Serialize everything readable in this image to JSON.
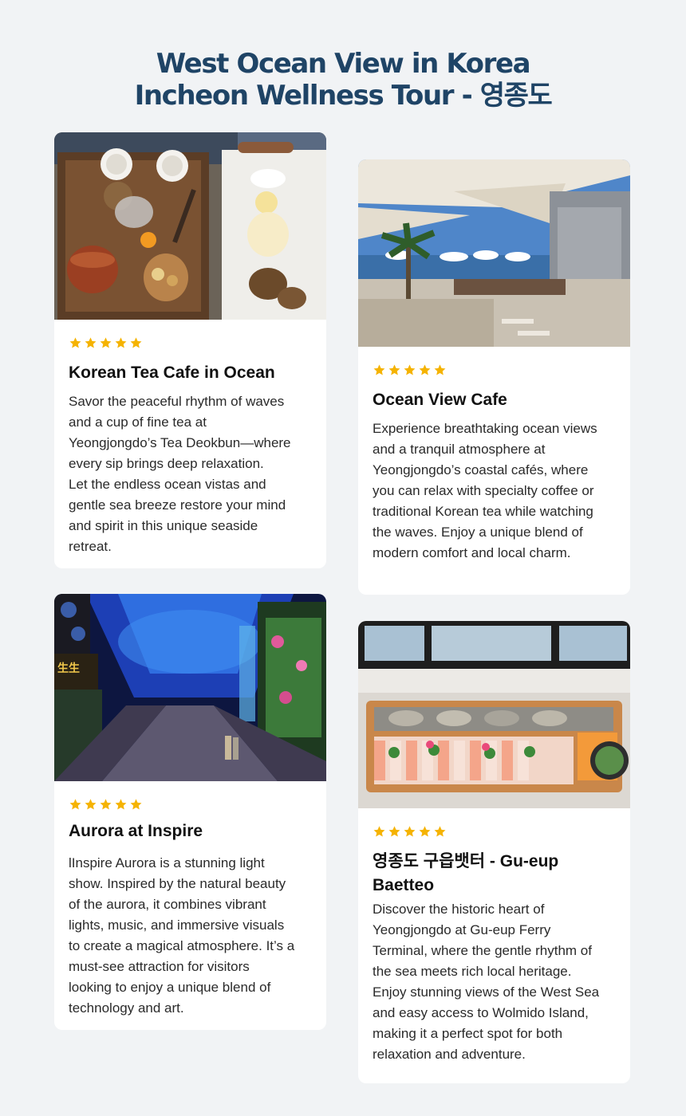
{
  "header": {
    "title_line1": "West Ocean View in Korea",
    "title_line2": "Incheon Wellness Tour - 영종도"
  },
  "colors": {
    "background": "#f1f3f5",
    "title": "#1f4466",
    "star": "#f5b301",
    "card": "#ffffff"
  },
  "cards": [
    {
      "rating": 5,
      "photo": "tea-set-photo",
      "title": "Korean Tea Cafe in Ocean",
      "description": "Savor the peaceful rhythm of waves\nand a cup of fine tea at\nYeongjongdo’s Tea Deokbun—where\nevery sip brings deep relaxation.\nLet the endless ocean vistas and\ngentle sea breeze restore your mind\nand spirit in this unique seaside\nretreat."
    },
    {
      "rating": 5,
      "photo": "ocean-terrace-photo",
      "title": "Ocean View Cafe",
      "description": "Experience breathtaking ocean views\nand a tranquil atmosphere at\nYeongjongdo’s coastal cafés, where\nyou can relax with specialty coffee or\ntraditional Korean tea while watching\nthe waves. Enjoy a unique blend of\nmodern comfort and local charm."
    },
    {
      "rating": 5,
      "photo": "aurora-light-show-photo",
      "title": "Aurora at Inspire",
      "description": "lInspire Aurora is a stunning light\nshow. Inspired by the natural beauty\nof the aurora, it combines vibrant\nlights, music, and immersive visuals\nto create a magical atmosphere. It’s a\nmust-see attraction for visitors\nlooking to enjoy a unique blend of\ntechnology and art."
    },
    {
      "rating": 5,
      "photo": "seafood-platter-photo",
      "title": "영종도 구읍뱃터 - Gu-eup\nBaetteo",
      "description": "Discover the historic heart of\nYeongjongdo at Gu-eup Ferry\nTerminal, where the gentle rhythm of\nthe sea meets rich local heritage.\nEnjoy stunning views of the West Sea\nand easy access to Wolmido Island,\nmaking it a perfect spot for both\nrelaxation and adventure."
    }
  ]
}
